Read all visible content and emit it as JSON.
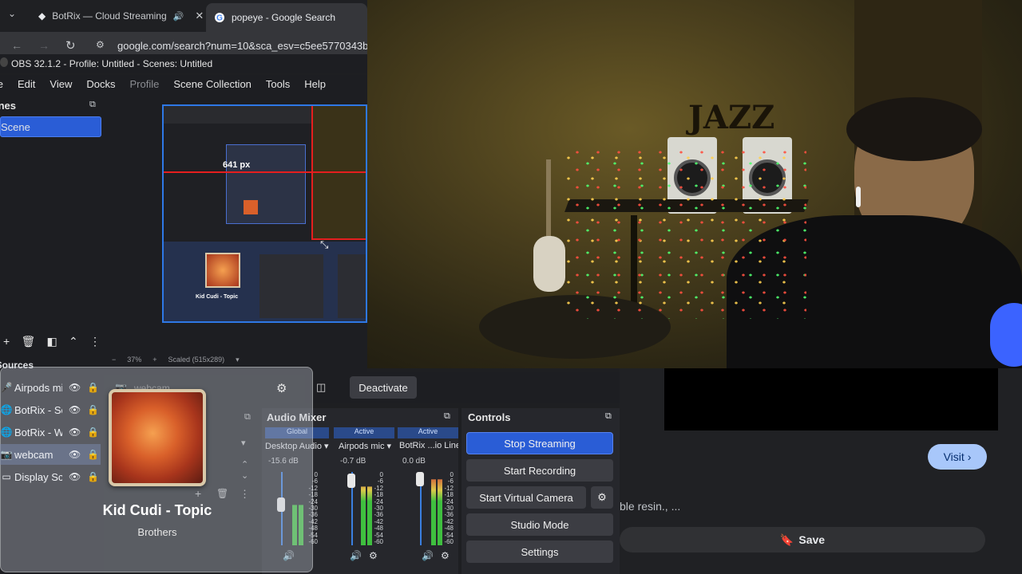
{
  "browser": {
    "tabs": [
      {
        "label": "BotRix — Cloud Streaming",
        "icon": "speaker-icon"
      },
      {
        "label": "popeye - Google Search"
      }
    ],
    "url": "google.com/search?num=10&sca_esv=c5ee5770343b"
  },
  "obs": {
    "title": "OBS 32.1.2 - Profile: Untitled - Scenes: Untitled",
    "menu": [
      "File",
      "Edit",
      "View",
      "Docks",
      "Profile",
      "Scene Collection",
      "Tools",
      "Help"
    ],
    "scenes": {
      "title": "Scenes",
      "items": [
        "Scene"
      ]
    },
    "preview": {
      "zoom": "37%",
      "scaled": "Scaled (515x289)",
      "measure": "641 px"
    },
    "sources": {
      "title": "Sources",
      "items": [
        {
          "name": "Airpods mic",
          "icon": "mic-icon"
        },
        {
          "name": "BotRix - Sc",
          "icon": "globe-icon"
        },
        {
          "name": "BotRix - W",
          "icon": "globe-icon"
        },
        {
          "name": "webcam",
          "icon": "camera-icon",
          "selected": true
        },
        {
          "name": "Display Sc",
          "icon": "monitor-icon"
        }
      ],
      "context_label": "webcam"
    },
    "deactivate_label": "Deactivate",
    "audio_mixer": {
      "title": "Audio Mixer",
      "channels": [
        {
          "status": "Global",
          "name": "Desktop Audio",
          "db": "-15.6 dB",
          "level": 0.55
        },
        {
          "status": "Active",
          "name": "Airpods mic",
          "db": "-0.7 dB",
          "level": 0.8
        },
        {
          "status": "Active",
          "name": "BotRix ...io Line",
          "db": "0.0 dB",
          "level": 0.9
        }
      ],
      "scale": [
        "0",
        "-6",
        "-12",
        "-18",
        "-24",
        "-30",
        "-36",
        "-42",
        "-48",
        "-54",
        "-60"
      ]
    },
    "controls": {
      "title": "Controls",
      "buttons": [
        "Stop Streaming",
        "Start Recording",
        "Start Virtual Camera",
        "Studio Mode",
        "Settings"
      ]
    }
  },
  "media_overlay": {
    "artist": "Kid Cudi - Topic",
    "track": "Brothers"
  },
  "google": {
    "visit_label": "Visit",
    "snippet": "ble resin., ...",
    "save_label": "Save"
  },
  "webcam": {
    "sign_text": "JAZZ"
  }
}
